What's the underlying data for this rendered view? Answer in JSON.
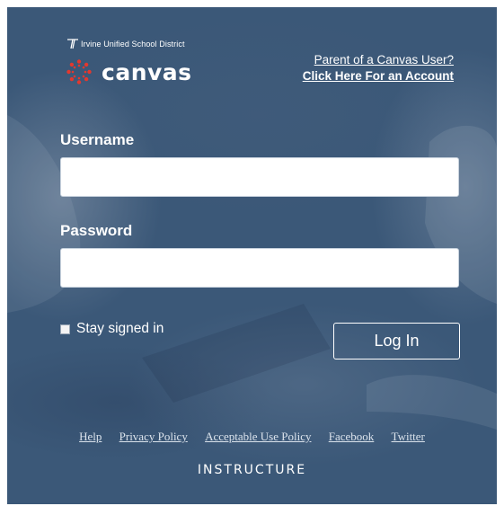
{
  "header": {
    "district_name": "Irvine Unified School District",
    "logo_wordmark": "canvas",
    "parent_link_line1": "Parent of a Canvas User?",
    "parent_link_line2": "Click Here For an Account"
  },
  "form": {
    "username_label": "Username",
    "username_value": "",
    "password_label": "Password",
    "password_value": "",
    "stay_signed_in_label": "Stay signed in",
    "stay_signed_in_checked": false,
    "login_button_label": "Log In"
  },
  "footer": {
    "links": [
      "Help",
      "Privacy Policy",
      "Acceptable Use Policy",
      "Facebook",
      "Twitter"
    ],
    "brand": "INSTRUCTURE"
  },
  "colors": {
    "panel_background": "#3b5878",
    "canvas_logo_red": "#e3382e",
    "text": "#ffffff"
  },
  "icons": {
    "district_logo": "district-logo-icon",
    "canvas_logo": "canvas-logo-icon"
  }
}
